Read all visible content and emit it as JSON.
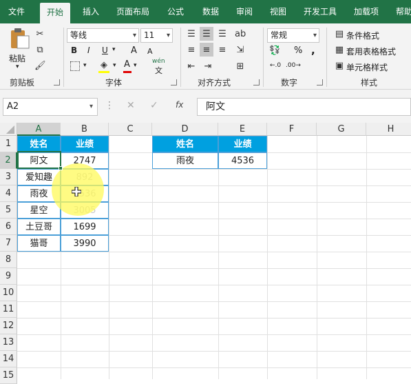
{
  "ribbon_tabs": [
    "文件",
    "开始",
    "插入",
    "页面布局",
    "公式",
    "数据",
    "审阅",
    "视图",
    "开发工具",
    "加载项",
    "帮助"
  ],
  "active_tab": "开始",
  "clipboard": {
    "paste_label": "粘贴",
    "group_label": "剪贴板"
  },
  "font": {
    "name": "等线",
    "size": "11",
    "group_label": "字体",
    "bold": "B",
    "italic": "I",
    "underline": "U",
    "grow": "A",
    "shrink": "A",
    "wen": "wén"
  },
  "alignment": {
    "group_label": "对齐方式"
  },
  "number": {
    "format": "常规",
    "group_label": "数字",
    "percent": "%",
    "comma": ","
  },
  "styles": {
    "conditional": "条件格式",
    "table_format": "套用表格格式",
    "cell_styles": "单元格样式",
    "group_label": "样式"
  },
  "formula_bar": {
    "name_box": "A2",
    "fx": "fx",
    "content": "阿文"
  },
  "columns": [
    "A",
    "B",
    "C",
    "D",
    "E",
    "F",
    "G",
    "H"
  ],
  "rows": [
    "1",
    "2",
    "3",
    "4",
    "5",
    "6",
    "7",
    "8",
    "9",
    "10",
    "11",
    "12",
    "13",
    "14",
    "15"
  ],
  "table1": {
    "headers": [
      "姓名",
      "业绩"
    ],
    "rows": [
      [
        "阿文",
        "2747"
      ],
      [
        "爱知趣",
        "892"
      ],
      [
        "雨夜",
        "4536"
      ],
      [
        "星空",
        "3005"
      ],
      [
        "土豆哥",
        "1699"
      ],
      [
        "猫哥",
        "3990"
      ]
    ]
  },
  "table2": {
    "headers": [
      "姓名",
      "业绩"
    ],
    "rows": [
      [
        "雨夜",
        "4536"
      ]
    ]
  },
  "colors": {
    "brand_green": "#217346",
    "header_blue": "#00a0e0",
    "highlight_yellow": "#fffa5a"
  }
}
